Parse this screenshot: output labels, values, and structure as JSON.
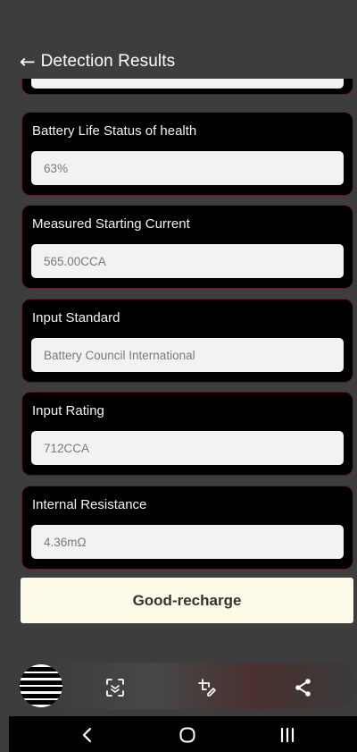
{
  "header": {
    "back_icon": "arrow-left-icon",
    "back_glyph": "←",
    "title": "Detection Results"
  },
  "cards": [
    {
      "label": "Battery Life Status of health",
      "value": "63%"
    },
    {
      "label": "Measured Starting Current",
      "value": "565.00CCA"
    },
    {
      "label": "Input Standard",
      "value": "Battery Council International"
    },
    {
      "label": "Input Rating",
      "value": "712CCA"
    },
    {
      "label": "Internal Resistance",
      "value": "4.36mΩ"
    }
  ],
  "result": {
    "label": "Good-recharge"
  },
  "toolbar": {
    "icons": [
      "menu-icon",
      "scan-icon",
      "edit-capture-icon",
      "share-icon"
    ]
  },
  "navigation": {
    "icons": [
      "back-nav-icon",
      "home-nav-icon",
      "recents-nav-icon"
    ]
  },
  "colors": {
    "background": "#3d3d3d",
    "card": "#000000",
    "card_border": "#5a1f24",
    "field": "#f2f2f2",
    "result_button": "#fdfae8"
  }
}
